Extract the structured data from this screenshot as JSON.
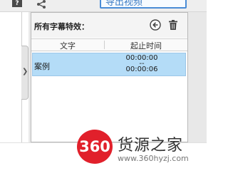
{
  "toolbar": {
    "help_icon_glyph": "?",
    "share_icon": "share-icon",
    "action_button_label": "导出视频"
  },
  "panel": {
    "title": "所有字幕特效：",
    "back_icon": "back-arrow-icon",
    "delete_icon": "trash-icon",
    "columns": {
      "text": "文字",
      "time": "起止时间"
    },
    "rows": [
      {
        "text": "案例",
        "start": "00:00:00",
        "separator": "--",
        "end": "00:00:06"
      }
    ]
  },
  "watermark": {
    "logo_text": "360",
    "name": "货源之家",
    "url": "www.360hyzj.com"
  },
  "colors": {
    "row_selected": "#b4dcf7",
    "accent": "#4a8cd6",
    "logo_red": "#e1202b"
  }
}
